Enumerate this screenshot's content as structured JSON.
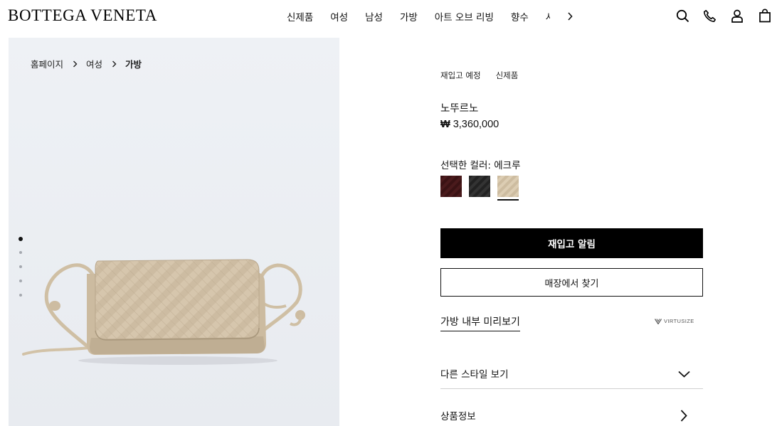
{
  "header": {
    "logo": "BOTTEGA VENETA",
    "nav": [
      "신제품",
      "여성",
      "남성",
      "가방",
      "아트 오브 리빙",
      "향수",
      "사"
    ],
    "icons": [
      "search-icon",
      "phone-icon",
      "account-icon",
      "shopping-bag-icon"
    ]
  },
  "breadcrumb": {
    "items": [
      "홈페이지",
      "여성",
      "가방"
    ]
  },
  "gallery": {
    "dots_total": 5,
    "active_dot": 1,
    "product_color": "#d4c4ad"
  },
  "product": {
    "tags": [
      "재입고 예정",
      "신제품"
    ],
    "name": "노뚜르노",
    "price_symbol": "₩",
    "price_value": "3,360,000",
    "color_label": "선택한 컬러: 에크루",
    "swatches": [
      {
        "name": "burgundy",
        "color": "#4a1a1c"
      },
      {
        "name": "black",
        "color": "#2b2b2b"
      },
      {
        "name": "ecru",
        "color": "#d9c9ad",
        "selected": true
      }
    ],
    "primary_button": "재입고 알림",
    "secondary_button": "매장에서 찾기",
    "preview_link": "가방 내부 미리보기",
    "virtusize_label": "VIRTUSIZE",
    "accordion": [
      {
        "label": "다른 스타일 보기",
        "icon": "chevron-down-icon"
      },
      {
        "label": "상품정보",
        "icon": "chevron-right-icon"
      }
    ]
  }
}
